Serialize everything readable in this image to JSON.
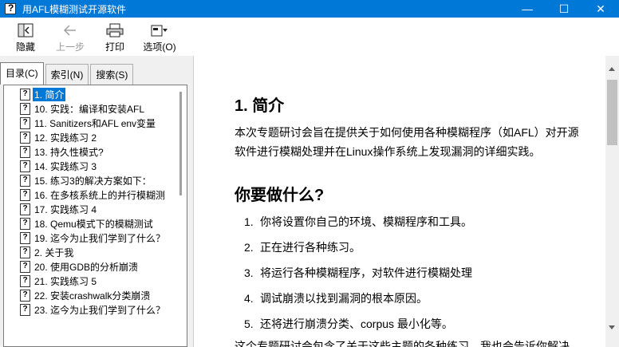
{
  "window": {
    "title": "用AFL模糊测试开源软件",
    "minimize": "—",
    "maximize": "☐",
    "close": "✕"
  },
  "toolbar": {
    "hide_label": "隐藏",
    "back_label": "上一步",
    "print_label": "打印",
    "options_label": "选项(O)"
  },
  "nav": {
    "tabs": [
      "目录(C)",
      "索引(N)",
      "搜索(S)"
    ],
    "items": [
      "1. 简介",
      "10. 实践：编译和安装AFL",
      "11. Sanitizers和AFL env变量",
      "12. 实践练习 2",
      "13. 持久性模式?",
      "14. 实践练习 3",
      "15. 练习3的解决方案如下：",
      "16. 在多核系统上的并行模糊测",
      "17. 实践练习 4",
      "18. Qemu模式下的模糊测试",
      "19. 迄今为止我们学到了什么？",
      "2. 关于我",
      "20. 使用GDB的分析崩溃",
      "21. 实践练习 5",
      "22. 安装crashwalk分类崩溃",
      "23. 迄今为止我们学到了什么？"
    ]
  },
  "content": {
    "h1": "1. 简介",
    "intro": "本次专题研讨会旨在提供关于如何使用各种模糊程序（如AFL）对开源软件进行模糊处理并在Linux操作系统上发现漏洞的详细实践。",
    "h2": "你要做什么?",
    "list": [
      {
        "num": "1.",
        "text": "你将设置你自己的环境、模糊程序和工具。"
      },
      {
        "num": "2.",
        "text": "正在进行各种练习。"
      },
      {
        "num": "3.",
        "text": "将运行各种模糊程序，对软件进行模糊处理"
      },
      {
        "num": "4.",
        "text": "调试崩溃以找到漏洞的根本原因。"
      },
      {
        "num": "5.",
        "text": "还将进行崩溃分类、corpus 最小化等。"
      }
    ],
    "outro": "这个专题研讨会包含了关于这些主题的各种练习，我也会告诉你解决"
  },
  "colors": {
    "titlebar": "#0078d7",
    "selection": "#0078d7"
  }
}
